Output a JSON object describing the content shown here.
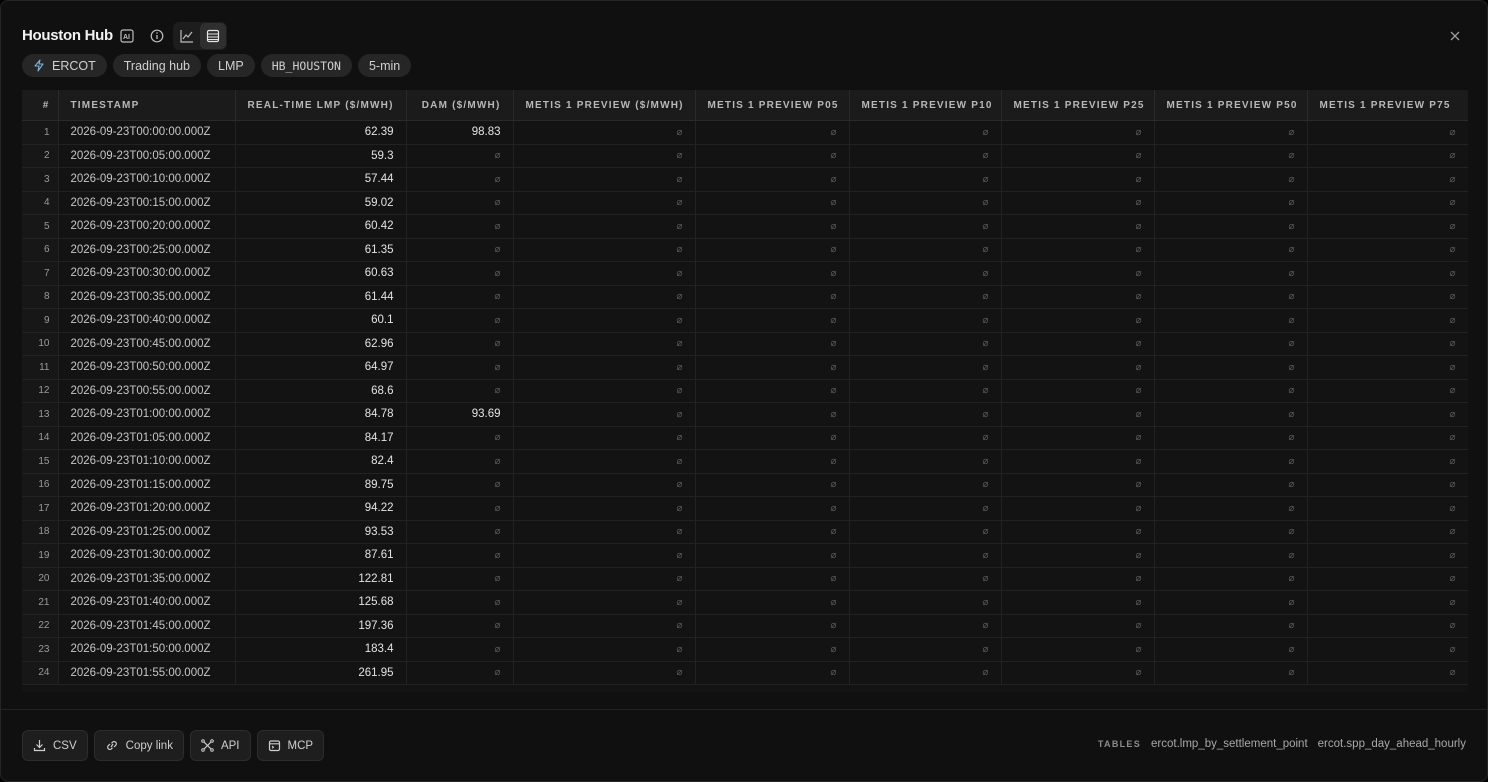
{
  "header": {
    "title": "Houston Hub"
  },
  "chips": [
    {
      "label": "ERCOT",
      "icon": "lightning-icon"
    },
    {
      "label": "Trading hub"
    },
    {
      "label": "LMP"
    },
    {
      "label": "HB_HOUSTON"
    },
    {
      "label": "5-min"
    }
  ],
  "table": {
    "columns": [
      "#",
      "TIMESTAMP",
      "REAL-TIME LMP ($/MWH)",
      "DAM ($/MWH)",
      "METIS 1 PREVIEW ($/MWH)",
      "METIS 1 PREVIEW P05",
      "METIS 1 PREVIEW P10",
      "METIS 1 PREVIEW P25",
      "METIS 1 PREVIEW P50",
      "METIS 1 PREVIEW P75"
    ],
    "null_symbol": "⌀",
    "rows": [
      {
        "i": "1",
        "ts": "2026-09-23T00:00:00.000Z",
        "rt": "62.39",
        "dam": "98.83"
      },
      {
        "i": "2",
        "ts": "2026-09-23T00:05:00.000Z",
        "rt": "59.3",
        "dam": null
      },
      {
        "i": "3",
        "ts": "2026-09-23T00:10:00.000Z",
        "rt": "57.44",
        "dam": null
      },
      {
        "i": "4",
        "ts": "2026-09-23T00:15:00.000Z",
        "rt": "59.02",
        "dam": null
      },
      {
        "i": "5",
        "ts": "2026-09-23T00:20:00.000Z",
        "rt": "60.42",
        "dam": null
      },
      {
        "i": "6",
        "ts": "2026-09-23T00:25:00.000Z",
        "rt": "61.35",
        "dam": null
      },
      {
        "i": "7",
        "ts": "2026-09-23T00:30:00.000Z",
        "rt": "60.63",
        "dam": null
      },
      {
        "i": "8",
        "ts": "2026-09-23T00:35:00.000Z",
        "rt": "61.44",
        "dam": null
      },
      {
        "i": "9",
        "ts": "2026-09-23T00:40:00.000Z",
        "rt": "60.1",
        "dam": null
      },
      {
        "i": "10",
        "ts": "2026-09-23T00:45:00.000Z",
        "rt": "62.96",
        "dam": null
      },
      {
        "i": "11",
        "ts": "2026-09-23T00:50:00.000Z",
        "rt": "64.97",
        "dam": null
      },
      {
        "i": "12",
        "ts": "2026-09-23T00:55:00.000Z",
        "rt": "68.6",
        "dam": null
      },
      {
        "i": "13",
        "ts": "2026-09-23T01:00:00.000Z",
        "rt": "84.78",
        "dam": "93.69"
      },
      {
        "i": "14",
        "ts": "2026-09-23T01:05:00.000Z",
        "rt": "84.17",
        "dam": null
      },
      {
        "i": "15",
        "ts": "2026-09-23T01:10:00.000Z",
        "rt": "82.4",
        "dam": null
      },
      {
        "i": "16",
        "ts": "2026-09-23T01:15:00.000Z",
        "rt": "89.75",
        "dam": null
      },
      {
        "i": "17",
        "ts": "2026-09-23T01:20:00.000Z",
        "rt": "94.22",
        "dam": null
      },
      {
        "i": "18",
        "ts": "2026-09-23T01:25:00.000Z",
        "rt": "93.53",
        "dam": null
      },
      {
        "i": "19",
        "ts": "2026-09-23T01:30:00.000Z",
        "rt": "87.61",
        "dam": null
      },
      {
        "i": "20",
        "ts": "2026-09-23T01:35:00.000Z",
        "rt": "122.81",
        "dam": null
      },
      {
        "i": "21",
        "ts": "2026-09-23T01:40:00.000Z",
        "rt": "125.68",
        "dam": null
      },
      {
        "i": "22",
        "ts": "2026-09-23T01:45:00.000Z",
        "rt": "197.36",
        "dam": null
      },
      {
        "i": "23",
        "ts": "2026-09-23T01:50:00.000Z",
        "rt": "183.4",
        "dam": null
      },
      {
        "i": "24",
        "ts": "2026-09-23T01:55:00.000Z",
        "rt": "261.95",
        "dam": null
      }
    ]
  },
  "footer": {
    "buttons": [
      {
        "label": "CSV",
        "icon": "download-icon"
      },
      {
        "label": "Copy link",
        "icon": "link-icon"
      },
      {
        "label": "API",
        "icon": "api-icon"
      },
      {
        "label": "MCP",
        "icon": "mcp-icon"
      }
    ],
    "tables_label": "TABLES",
    "tables": [
      "ercot.lmp_by_settlement_point",
      "ercot.spp_day_ahead_hourly"
    ]
  }
}
